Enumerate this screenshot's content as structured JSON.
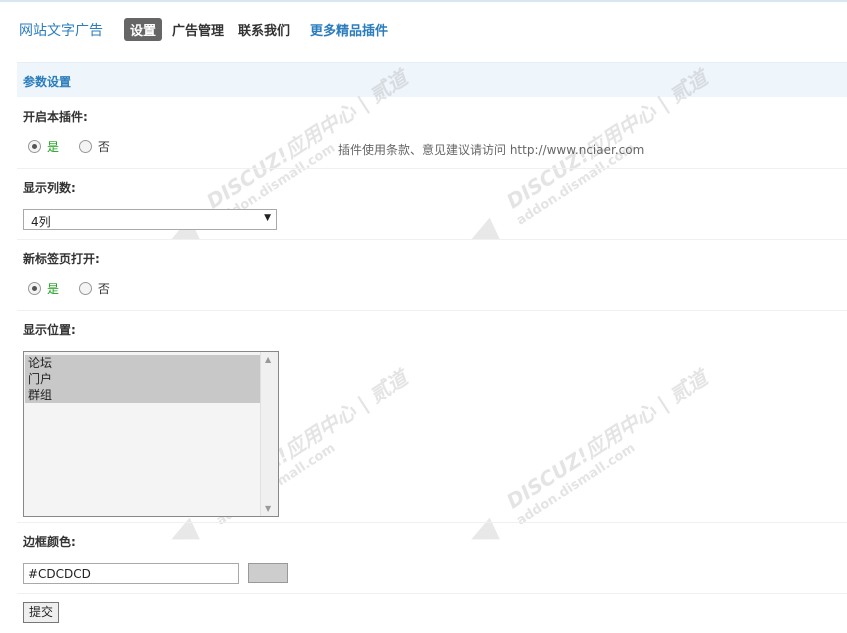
{
  "header": {
    "app_title": "网站文字广告",
    "tabs": [
      {
        "label": "设置",
        "active": true
      },
      {
        "label": "广告管理",
        "active": false
      },
      {
        "label": "联系我们",
        "active": false
      }
    ],
    "more_link": "更多精品插件"
  },
  "section": {
    "title": "参数设置"
  },
  "hint": "插件使用条款、意见建议请访问 http://www.nciaer.com",
  "fields": {
    "enable": {
      "label": "开启本插件:",
      "yes": "是",
      "no": "否",
      "selected": "yes"
    },
    "columns": {
      "label": "显示列数:",
      "value": "4列"
    },
    "new_tab": {
      "label": "新标签页打开:",
      "yes": "是",
      "no": "否",
      "selected": "yes"
    },
    "position": {
      "label": "显示位置:",
      "options": [
        "论坛",
        "门户",
        "群组"
      ]
    },
    "border_color": {
      "label": "边框颜色:",
      "value": "#CDCDCD",
      "swatch": "#cdcdcd"
    }
  },
  "submit_label": "提交",
  "watermark": {
    "brand": "DISCUZ!应用中心 | 贰道",
    "url": "addon.dismall.com"
  },
  "colors": {
    "accent": "#2b7dbc",
    "yes_green": "#1aa01a",
    "section_bg": "#eef5fb"
  }
}
